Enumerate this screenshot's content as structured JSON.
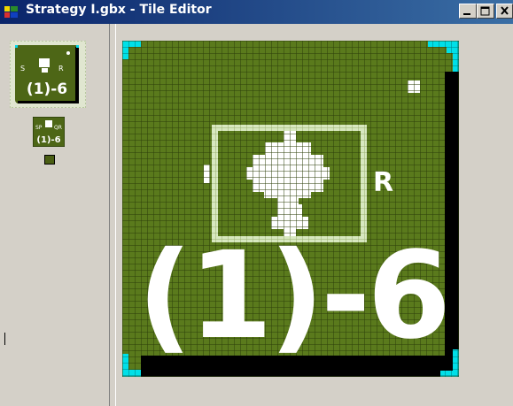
{
  "window": {
    "title": "Strategy I.gbx - Tile Editor",
    "buttons": [
      "minimize",
      "maximize",
      "close"
    ]
  },
  "left_panel": {
    "tiles": [
      {
        "name": "large-tile",
        "text_top_left": "S",
        "text_top_right": "R",
        "text_bottom": "(1)-6",
        "selected": true
      },
      {
        "name": "small-tile",
        "text_top_left": "SP",
        "text_top_right": "QR",
        "text_bottom": "(1)-6"
      }
    ],
    "swatch_color": "#4a5e13"
  },
  "editor": {
    "tile_text_right": "R",
    "tile_text_bottom": "(1)-6",
    "colors": {
      "background": "#5a7a1c",
      "grid_line": "#2c3f0a",
      "highlight": "#d8e8c0",
      "shadow": "#000000",
      "corner": "#00e0e8"
    }
  }
}
